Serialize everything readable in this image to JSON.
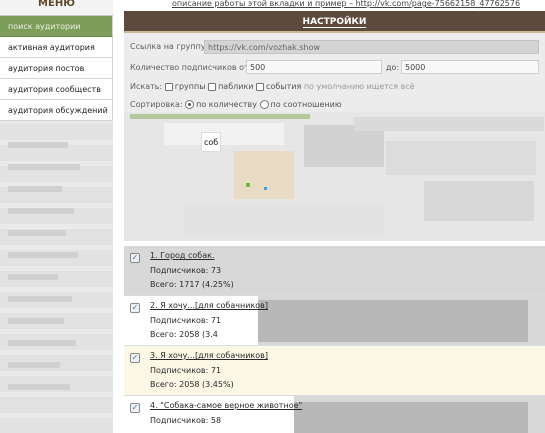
{
  "header": {
    "top_link": "описание работы этой вкладки и пример – http://vk.com/page-75662158_47762576"
  },
  "sidebar": {
    "title": "МЕНЮ",
    "items": [
      {
        "label": "поиск аудитории",
        "active": true
      },
      {
        "label": "активная аудитория",
        "active": false
      },
      {
        "label": "аудитория постов",
        "active": false
      },
      {
        "label": "аудитория сообществ",
        "active": false
      },
      {
        "label": "аудитория обсуждений",
        "active": false
      }
    ]
  },
  "settings": {
    "title": "НАСТРОЙКИ",
    "group_link_label": "Ссылка на группу:",
    "group_link_value": "https://vk.com/vozhak.show",
    "subs_label": "Количество подписчиков от:",
    "subs_from": "500",
    "subs_to_label": "до:",
    "subs_to": "5000",
    "search_label": "Искать:",
    "opt_groups": "группы",
    "opt_publics": "паблики",
    "opt_events": "события",
    "search_hint": "по умолчанию ищется всё",
    "sort_label": "Сортировка:",
    "sort_by_count": "по количеству",
    "sort_by_ratio": "по соотношению"
  },
  "tooltip": {
    "text": "соб"
  },
  "results": [
    {
      "title": "1. Город собак.",
      "subs": "Подписчиков: 73",
      "total": "Всего: 1717 (4.25%)"
    },
    {
      "title": "2. Я хочу...[для собачников]",
      "subs": "Подписчиков: 71",
      "total": "Всего: 2058 (3.4"
    },
    {
      "title": "3. Я хочу...[для собачников]",
      "subs": "Подписчиков: 71",
      "total": "Всего: 2058 (3.45%)"
    },
    {
      "title": "4. \"Собака-самое верное животное\"",
      "subs": "Подписчиков: 58",
      "total": ""
    }
  ],
  "icons": {
    "check": "checkbox-checked-icon"
  },
  "colors": {
    "menu_active": "#7d9d5b",
    "panel_header": "#5e4a3c"
  }
}
